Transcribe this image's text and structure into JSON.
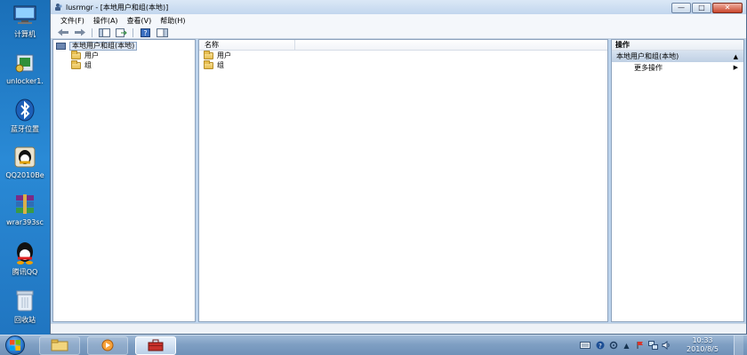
{
  "desktop": {
    "icons": [
      {
        "label": "计算机",
        "icon": "computer-icon"
      },
      {
        "label": "unlocker1.",
        "icon": "unlocker-icon"
      },
      {
        "label": "蓝牙位置",
        "icon": "bluetooth-icon"
      },
      {
        "label": "QQ2010Be",
        "icon": "qq-installer-icon"
      },
      {
        "label": "wrar393sc",
        "icon": "winrar-icon"
      },
      {
        "label": "腾讯QQ",
        "icon": "qq-icon"
      },
      {
        "label": "回收站",
        "icon": "recycle-bin-icon"
      }
    ]
  },
  "window": {
    "title": "lusrmgr - [本地用户和组(本地)]",
    "menu": [
      "文件(F)",
      "操作(A)",
      "查看(V)",
      "帮助(H)"
    ],
    "controls": {
      "minimize": "—",
      "maximize": "□",
      "close": "✕"
    }
  },
  "tree": {
    "root": "本地用户和组(本地)",
    "children": [
      "用户",
      "组"
    ]
  },
  "list": {
    "column_name": "名称",
    "items": [
      "用户",
      "组"
    ]
  },
  "actions": {
    "header": "操作",
    "section": "本地用户和组(本地)",
    "items": [
      "更多操作"
    ]
  },
  "taskbar": {
    "clock_time": "10:33",
    "clock_date": "2010/8/5"
  },
  "colors": {
    "desktop": "#1f73be",
    "window_frame": "#bcd3ec",
    "folder": "#e7be4f"
  }
}
